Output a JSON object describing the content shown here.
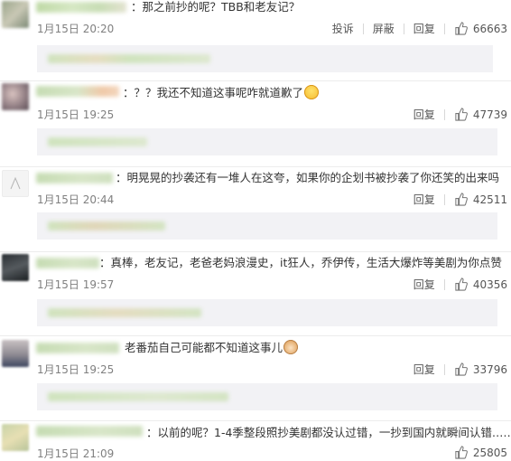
{
  "actions": {
    "report": "投诉",
    "block": "屏蔽",
    "reply": "回复"
  },
  "comments": [
    {
      "text": "：那之前抄的呢？TBB和老友记？",
      "time": "1月15日 20:20",
      "likes": "66663",
      "emoji": ""
    },
    {
      "text": "：？？我还不知道这事呢咋就道歉了",
      "time": "1月15日 19:25",
      "likes": "47739",
      "emoji": "laugh-cry"
    },
    {
      "text": "：明晃晃的抄袭还有一堆人在这夸，如果你的企划书被抄袭了你还笑的出来吗",
      "time": "1月15日 20:44",
      "likes": "42511",
      "emoji": ""
    },
    {
      "text": "：真棒，老友记，老爸老妈浪漫史，it狂人，乔伊传，生活大爆炸等美剧为你点赞",
      "time": "1月15日 19:57",
      "likes": "40356",
      "emoji": ""
    },
    {
      "text": "老番茄自己可能都不知道这事儿",
      "time": "1月15日 19:25",
      "likes": "33796",
      "emoji": "cat"
    },
    {
      "text": "：以前的呢？1-4季整段照抄美剧都没认过错，一抄到国内就瞬间认错……",
      "time": "1月15日 21:09",
      "likes": "25805",
      "emoji": "laugh-cry"
    }
  ]
}
